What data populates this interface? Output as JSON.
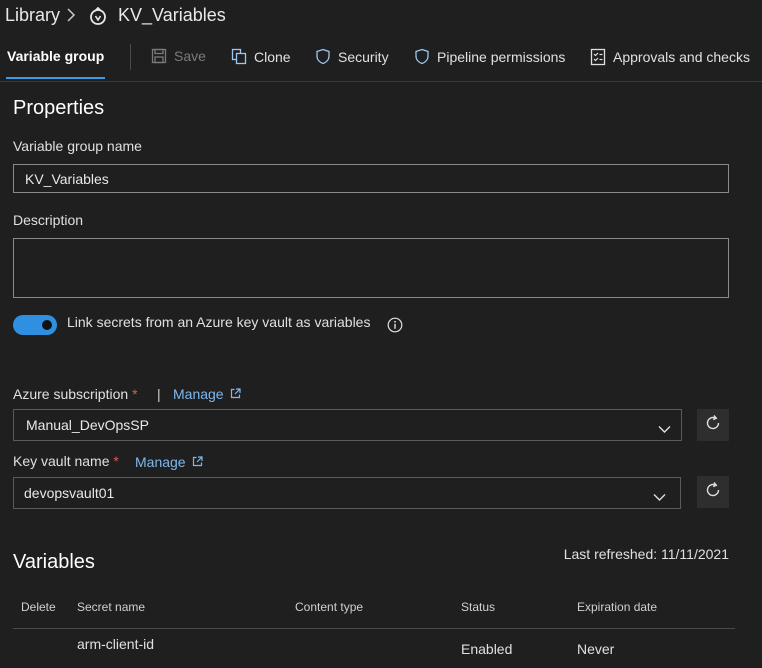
{
  "breadcrumb": {
    "root": "Library",
    "current": "KV_Variables"
  },
  "toolbar": {
    "active_tab": "Variable group",
    "save": "Save",
    "clone": "Clone",
    "security": "Security",
    "pipeline_permissions": "Pipeline permissions",
    "approvals": "Approvals and checks"
  },
  "properties": {
    "title": "Properties",
    "name_label": "Variable group name",
    "name_value": "KV_Variables",
    "description_label": "Description",
    "description_value": "",
    "link_secrets_label": "Link secrets from an Azure key vault as variables",
    "link_secrets_enabled": true
  },
  "keyvault": {
    "subscription_label": "Azure subscription",
    "required_mark": "*",
    "divider": "|",
    "manage": "Manage",
    "subscription_value": "Manual_DevOpsSP",
    "vault_label": "Key vault name",
    "vault_value": "devopsvault01"
  },
  "variables": {
    "title": "Variables",
    "last_refreshed": "Last refreshed: 11/11/2021",
    "columns": [
      "Delete",
      "Secret name",
      "Content type",
      "Status",
      "Expiration date"
    ],
    "rows": [
      {
        "delete": "",
        "secret_name": "arm-client-id",
        "content_type": "",
        "status": "Enabled",
        "expiration": "Never"
      }
    ]
  },
  "colors": {
    "background": "#1f1f1f",
    "accent": "#3b9ae1",
    "link": "#7fb8ef",
    "required": "#e05a5a"
  },
  "icons": [
    "chevron-right-icon",
    "variable-group-icon",
    "save-icon",
    "clone-icon",
    "shield-icon",
    "checklist-icon",
    "info-icon",
    "external-link-icon",
    "chevron-down-icon",
    "refresh-icon"
  ]
}
